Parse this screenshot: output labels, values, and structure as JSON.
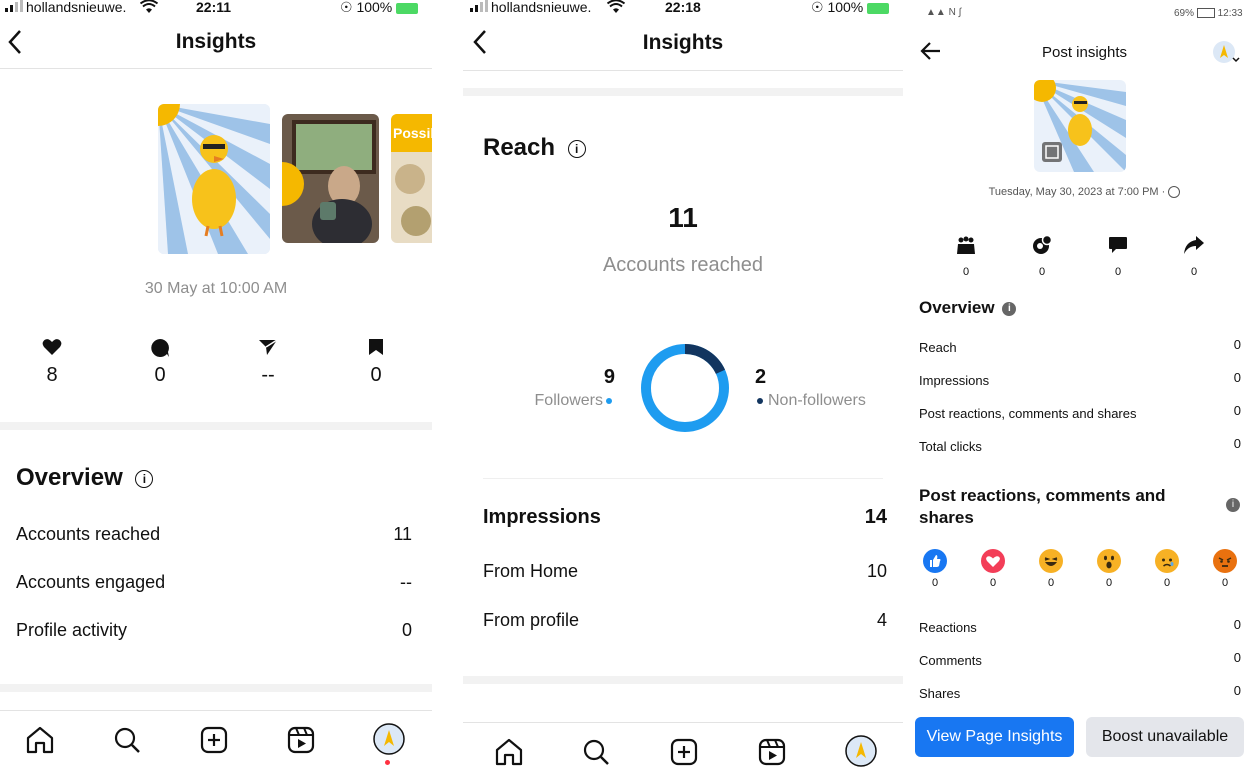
{
  "panel1": {
    "status": {
      "carrier": "hollandsnieuwe.",
      "time": "22:11",
      "battery": "100%"
    },
    "title": "Insights",
    "date": "30 May at 10:00 AM",
    "thumb3_text": "Possib",
    "stats": [
      {
        "icon": "heart-icon",
        "value": "8"
      },
      {
        "icon": "comment-icon",
        "value": "0"
      },
      {
        "icon": "share-icon",
        "value": "--"
      },
      {
        "icon": "bookmark-icon",
        "value": "0"
      }
    ],
    "overview_title": "Overview",
    "overview_rows": [
      {
        "label": "Accounts reached",
        "value": "11"
      },
      {
        "label": "Accounts engaged",
        "value": "--"
      },
      {
        "label": "Profile activity",
        "value": "0"
      }
    ]
  },
  "panel2": {
    "status": {
      "carrier": "hollandsnieuwe.",
      "time": "22:18",
      "battery": "100%"
    },
    "title": "Insights",
    "reach_title": "Reach",
    "accounts_reached_value": "11",
    "accounts_reached_label": "Accounts reached",
    "followers_value": "9",
    "followers_label": "Followers",
    "nonfollowers_value": "2",
    "nonfollowers_label": "Non-followers",
    "donut": {
      "followers": 9,
      "non_followers": 2,
      "followers_color": "#1e9cf0",
      "non_followers_color": "#12355f"
    },
    "impressions_title": "Impressions",
    "impressions_value": "14",
    "impression_rows": [
      {
        "label": "From Home",
        "value": "10"
      },
      {
        "label": "From profile",
        "value": "4"
      }
    ]
  },
  "panel3": {
    "status": {
      "battery": "69%",
      "time": "12:33"
    },
    "title": "Post insights",
    "date": "Tuesday, May 30, 2023 at 7:00 PM ·",
    "top_stats": [
      {
        "icon": "people-icon",
        "value": "0"
      },
      {
        "icon": "add-people-icon",
        "value": "0"
      },
      {
        "icon": "comment-icon",
        "value": "0"
      },
      {
        "icon": "share-arrow-icon",
        "value": "0"
      }
    ],
    "overview_title": "Overview",
    "overview_rows": [
      {
        "label": "Reach",
        "value": "0"
      },
      {
        "label": "Impressions",
        "value": "0"
      },
      {
        "label": "Post reactions, comments and shares",
        "value": "0"
      },
      {
        "label": "Total clicks",
        "value": "0"
      }
    ],
    "prc_title_line1": "Post reactions, comments and",
    "prc_title_line2": "shares",
    "reactions": [
      {
        "name": "like",
        "count": "0",
        "color": "#1877f2"
      },
      {
        "name": "love",
        "count": "0",
        "color": "#f33e58"
      },
      {
        "name": "haha",
        "count": "0",
        "color": "#f7b125"
      },
      {
        "name": "wow",
        "count": "0",
        "color": "#f7b125"
      },
      {
        "name": "sad",
        "count": "0",
        "color": "#f7b125"
      },
      {
        "name": "angry",
        "count": "0",
        "color": "#e9710f"
      }
    ],
    "bottom_rows": [
      {
        "label": "Reactions",
        "value": "0"
      },
      {
        "label": "Comments",
        "value": "0"
      },
      {
        "label": "Shares",
        "value": "0"
      }
    ],
    "view_button": "View Page Insights",
    "boost_button": "Boost unavailable",
    "accent": "#1877f2"
  }
}
